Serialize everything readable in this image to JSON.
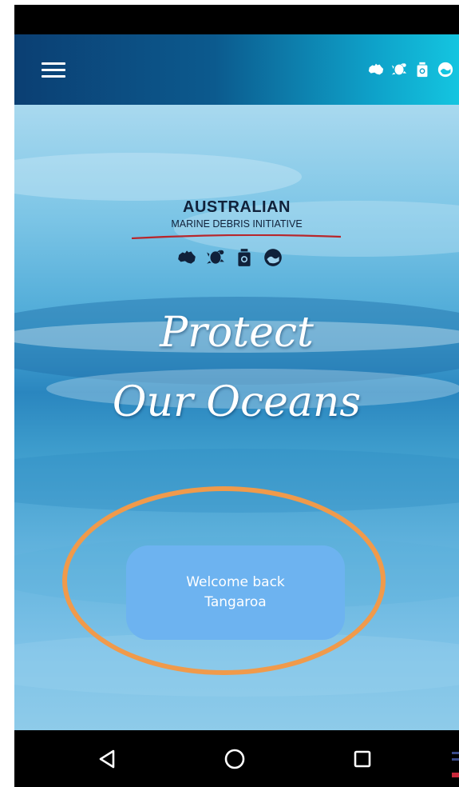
{
  "app_bar": {
    "menu_icon": "hamburger-menu-icon",
    "icons": [
      "australia-icon",
      "turtle-icon",
      "bin-icon",
      "globe-icon"
    ]
  },
  "brand": {
    "title": "AUSTRALIAN",
    "subtitle": "MARINE DEBRIS INITIATIVE",
    "icons": [
      "australia-icon",
      "turtle-icon",
      "bin-icon",
      "globe-icon"
    ],
    "underline_color": "#b8262b"
  },
  "hero": {
    "tagline_line1": "Protect",
    "tagline_line2": "Our Oceans"
  },
  "welcome_button": {
    "line1": "Welcome back",
    "line2": "Tangaroa",
    "color": "#6db3f0"
  },
  "annotation": {
    "ring_color": "#f09a4b"
  },
  "nav_bar": {
    "icons": [
      "back-triangle-icon",
      "home-circle-icon",
      "recents-square-icon"
    ]
  }
}
